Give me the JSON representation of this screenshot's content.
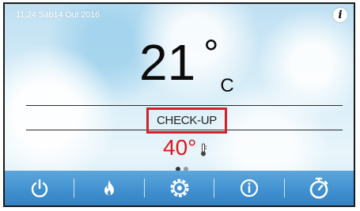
{
  "status_bar": {
    "datetime": "11:24 Sáb14 Out 2016",
    "info_icon": "i"
  },
  "main": {
    "temperature": "21",
    "degree_symbol": "°",
    "unit": "C",
    "status": "CHECK-UP",
    "setpoint": "40°"
  },
  "pager": {
    "pages": 2,
    "active_page": 1
  },
  "toolbar": {
    "buttons": [
      "power-icon",
      "flame-icon",
      "gear-icon",
      "info-icon",
      "timer-icon"
    ]
  },
  "colors": {
    "status_highlight": "#d4202a",
    "setpoint": "#e0151c",
    "toolbar": "#3f8fcf"
  }
}
